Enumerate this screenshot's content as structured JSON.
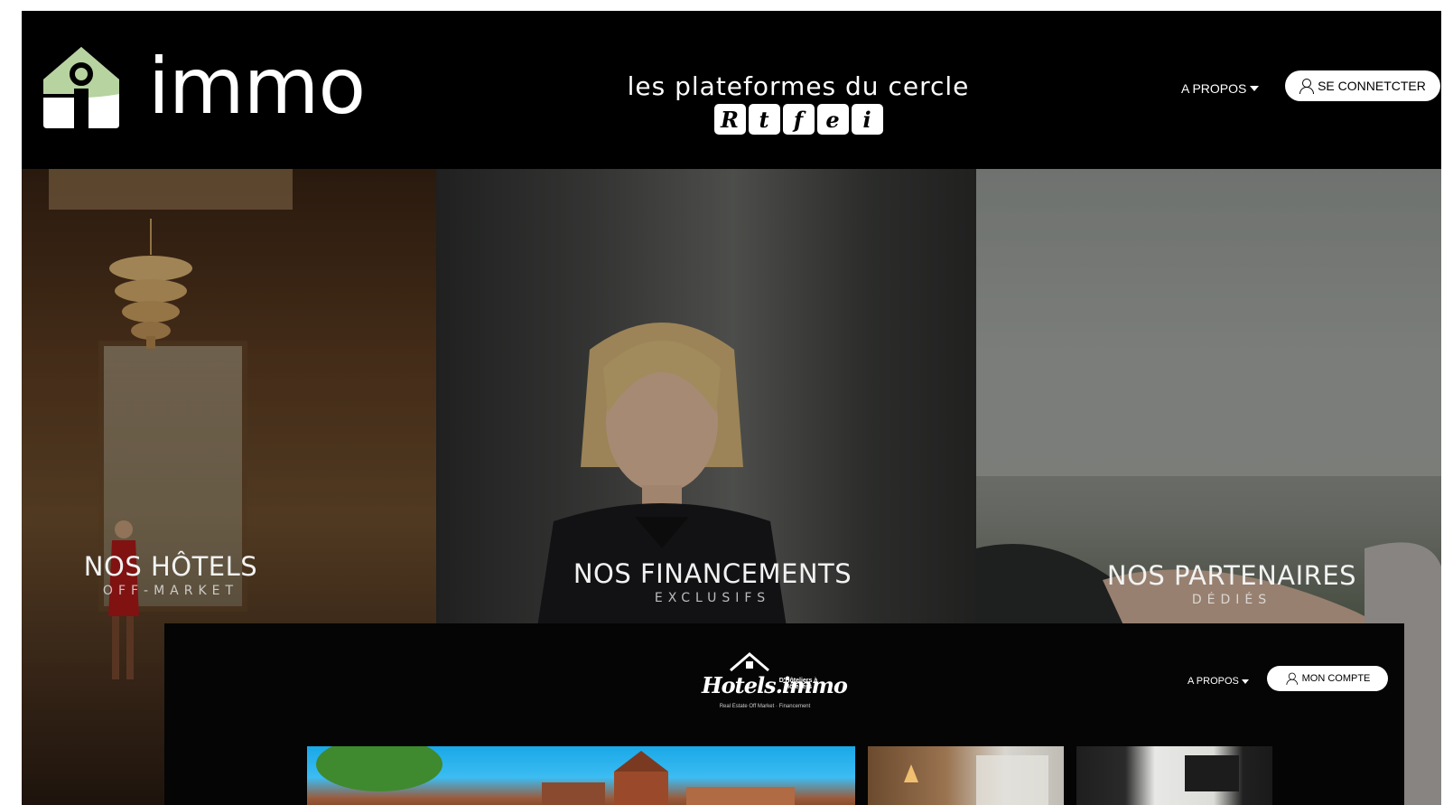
{
  "header": {
    "logo_word": "immo",
    "cercle_text": "les plateformes du cercle",
    "cercle_letters": [
      "R",
      "t",
      "f",
      "e",
      "i"
    ],
    "about_label": "A PROPOS",
    "login_label": "SE CONNETCTER"
  },
  "panels": [
    {
      "title": "NOS HÔTELS",
      "subtitle": "OFF-MARKET"
    },
    {
      "title": "NOS FINANCEMENTS",
      "subtitle": "EXCLUSIFS"
    },
    {
      "title": "NOS PARTENAIRES",
      "subtitle": "DÉDIÉS"
    }
  ],
  "inset": {
    "brand": "Hotels.immo",
    "brand_small": "D'Hôteliers à Hôteliers",
    "tagline": "Real Estate Off Market · Financement",
    "about_label": "A PROPOS",
    "account_label": "MON COMPTE"
  },
  "colors": {
    "background": "#000000",
    "logo_green": "#b7d3a0",
    "button_bg": "#ffffff"
  }
}
